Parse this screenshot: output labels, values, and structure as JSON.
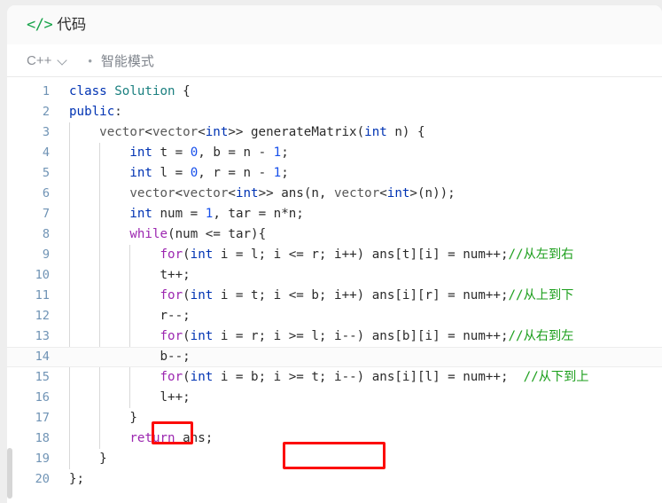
{
  "header": {
    "icon": "code-brackets-icon",
    "title": "代码"
  },
  "toolbar": {
    "language": "C++",
    "chevron_icon": "chevron-down-icon",
    "separator": "•",
    "mode_label": "智能模式"
  },
  "editor": {
    "language": "C++",
    "current_line": 14,
    "line_count": 20,
    "colors": {
      "keyword": "#0033b3",
      "control_keyword": "#9c27b0",
      "type": "#1a7f7f",
      "number": "#1750eb",
      "comment": "#1a9e1a",
      "plain": "#2b2b2b",
      "line_number": "#6f93b5",
      "annotation_box": "#fc0b06"
    },
    "lines": [
      {
        "n": "1",
        "text": "class Solution {"
      },
      {
        "n": "2",
        "text": "public:"
      },
      {
        "n": "3",
        "text": "    vector<vector<int>> generateMatrix(int n) {"
      },
      {
        "n": "4",
        "text": "        int t = 0, b = n - 1;"
      },
      {
        "n": "5",
        "text": "        int l = 0, r = n - 1;"
      },
      {
        "n": "6",
        "text": "        vector<vector<int>> ans(n, vector<int>(n));"
      },
      {
        "n": "7",
        "text": "        int num = 1, tar = n*n;"
      },
      {
        "n": "8",
        "text": "        while(num <= tar){"
      },
      {
        "n": "9",
        "text": "            for(int i = l; i <= r; i++) ans[t][i] = num++;//从左到右"
      },
      {
        "n": "10",
        "text": "            t++;"
      },
      {
        "n": "11",
        "text": "            for(int i = t; i <= b; i++) ans[i][r] = num++;//从上到下"
      },
      {
        "n": "12",
        "text": "            r--;"
      },
      {
        "n": "13",
        "text": "            for(int i = r; i >= l; i--) ans[b][i] = num++;//从右到左"
      },
      {
        "n": "14",
        "text": "            b--;"
      },
      {
        "n": "15",
        "text": "            for(int i = b; i >= t; i--) ans[i][l] = num++;  //从下到上"
      },
      {
        "n": "16",
        "text": "            l++;"
      },
      {
        "n": "17",
        "text": "        }"
      },
      {
        "n": "18",
        "text": "        return ans;"
      },
      {
        "n": "19",
        "text": "    }"
      },
      {
        "n": "20",
        "text": "};"
      }
    ],
    "annotations": [
      {
        "label": "b--;",
        "line": 14
      },
      {
        "label": "i >= t; i--",
        "line": 15
      }
    ]
  }
}
